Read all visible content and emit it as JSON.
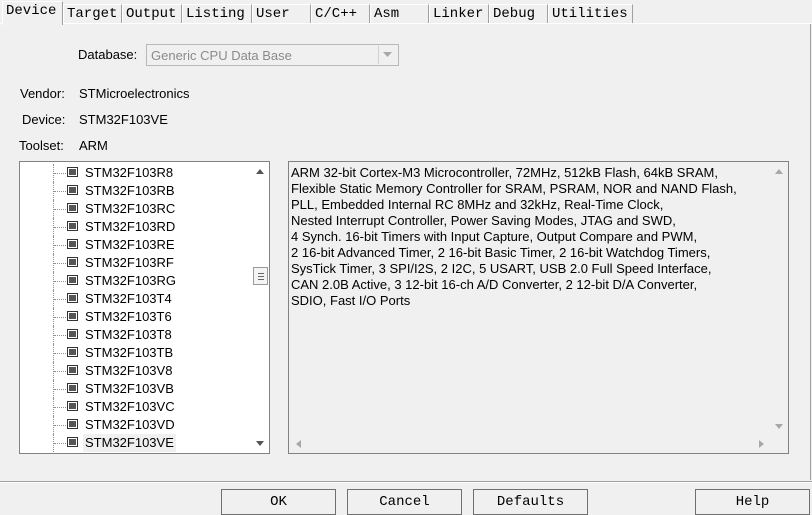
{
  "tabs": [
    {
      "label": "Device",
      "active": true
    },
    {
      "label": "Target"
    },
    {
      "label": "Output"
    },
    {
      "label": "Listing"
    },
    {
      "label": "User"
    },
    {
      "label": "C/C++"
    },
    {
      "label": "Asm"
    },
    {
      "label": "Linker"
    },
    {
      "label": "Debug"
    },
    {
      "label": "Utilities"
    }
  ],
  "database": {
    "label": "Database:",
    "value": "Generic CPU Data Base"
  },
  "vendor": {
    "label": "Vendor:",
    "value": "STMicroelectronics"
  },
  "device": {
    "label": "Device:",
    "value": "STM32F103VE"
  },
  "toolset": {
    "label": "Toolset:",
    "value": "ARM"
  },
  "device_list": [
    "STM32F103R8",
    "STM32F103RB",
    "STM32F103RC",
    "STM32F103RD",
    "STM32F103RE",
    "STM32F103RF",
    "STM32F103RG",
    "STM32F103T4",
    "STM32F103T6",
    "STM32F103T8",
    "STM32F103TB",
    "STM32F103V8",
    "STM32F103VB",
    "STM32F103VC",
    "STM32F103VD",
    "STM32F103VE"
  ],
  "selected_device": "STM32F103VE",
  "description": [
    "ARM 32-bit Cortex-M3 Microcontroller, 72MHz, 512kB Flash, 64kB SRAM,",
    "Flexible Static Memory Controller for SRAM, PSRAM, NOR and NAND Flash,",
    "PLL, Embedded Internal RC 8MHz and 32kHz, Real-Time Clock,",
    "Nested Interrupt Controller, Power Saving Modes, JTAG and SWD,",
    "4 Synch. 16-bit Timers with Input Capture, Output Compare and PWM,",
    "2 16-bit Advanced Timer, 2 16-bit Basic Timer, 2 16-bit Watchdog Timers,",
    "SysTick Timer, 3 SPI/I2S, 2 I2C, 5 USART, USB 2.0 Full Speed Interface,",
    "CAN 2.0B Active, 3 12-bit 16-ch A/D Converter, 2 12-bit D/A Converter,",
    "SDIO, Fast I/O Ports"
  ],
  "buttons": {
    "ok": "OK",
    "cancel": "Cancel",
    "defaults": "Defaults",
    "help": "Help"
  }
}
